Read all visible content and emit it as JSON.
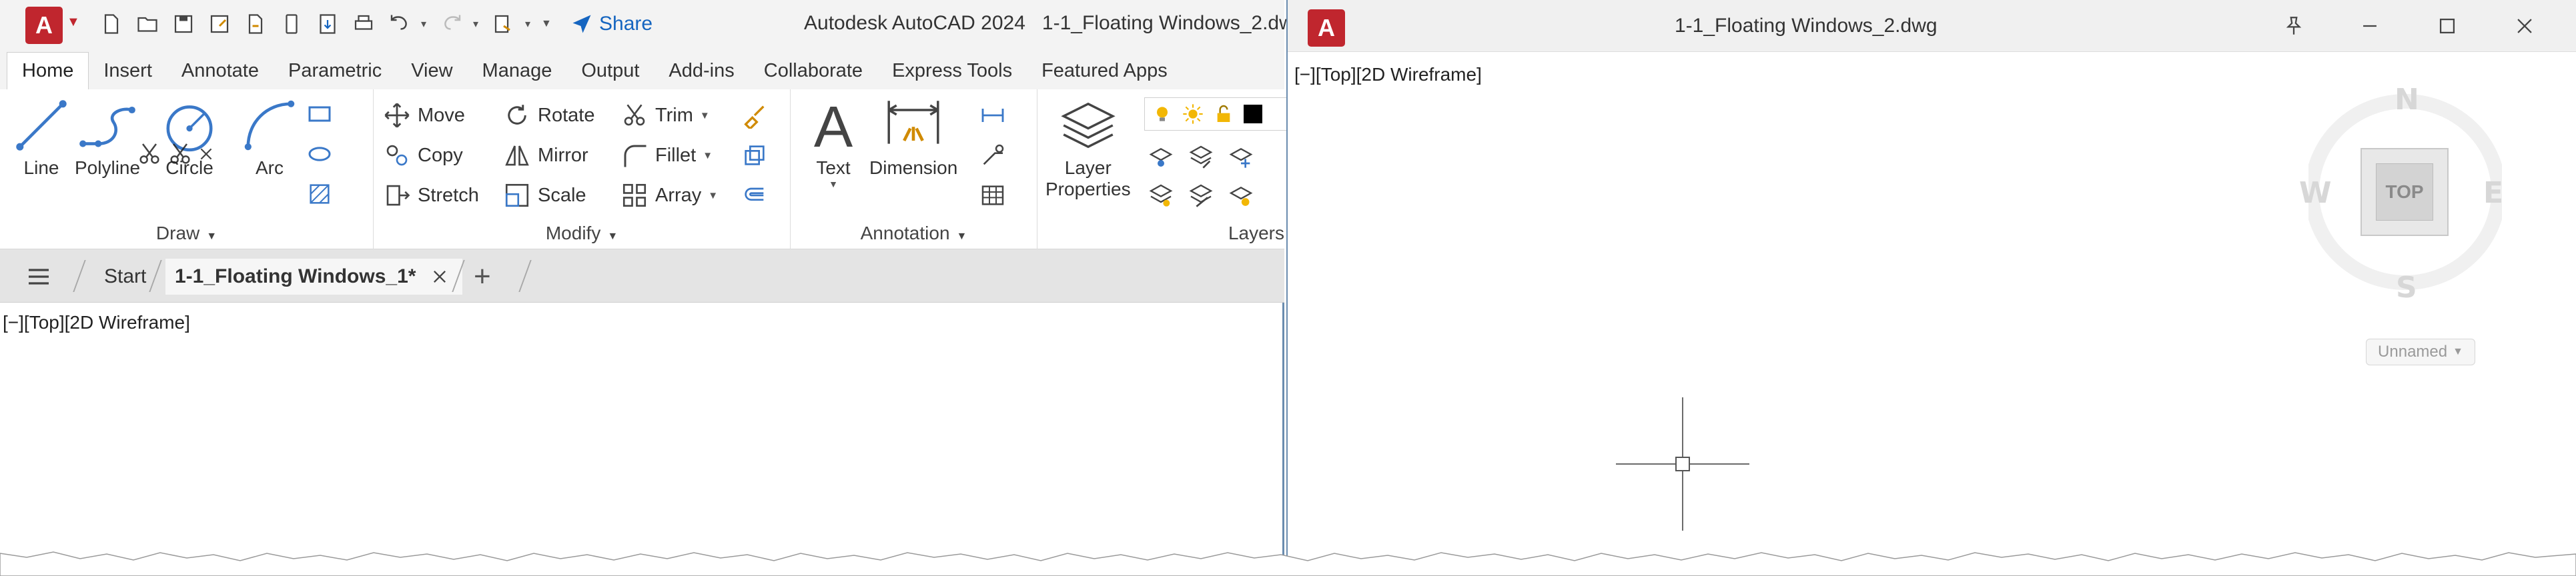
{
  "app": {
    "logo_letter": "A",
    "title": "Autodesk AutoCAD 2024",
    "current_file": "1-1_Floating Windows_2.dwg",
    "share_label": "Share",
    "accent": "#c0262e",
    "share_color": "#1565c0"
  },
  "ribbon_tabs": [
    "Home",
    "Insert",
    "Annotate",
    "Parametric",
    "View",
    "Manage",
    "Output",
    "Add-ins",
    "Collaborate",
    "Express Tools",
    "Featured Apps"
  ],
  "ribbon": {
    "draw": {
      "title": "Draw",
      "line": "Line",
      "polyline": "Polyline",
      "circle": "Circle",
      "arc": "Arc"
    },
    "modify": {
      "title": "Modify",
      "move": "Move",
      "rotate": "Rotate",
      "trim": "Trim",
      "copy": "Copy",
      "mirror": "Mirror",
      "fillet": "Fillet",
      "stretch": "Stretch",
      "scale": "Scale",
      "array": "Array"
    },
    "annotation": {
      "title": "Annotation",
      "text": "Text",
      "dimension": "Dimension"
    },
    "layers": {
      "title": "Layers",
      "properties_line1": "Layer",
      "properties_line2": "Properties"
    }
  },
  "file_tabs": {
    "start": "Start",
    "active": "1-1_Floating Windows_1*",
    "add": "+"
  },
  "viewport_main": {
    "label": "[−][Top][2D Wireframe]"
  },
  "floating_window": {
    "title": "1-1_Floating Windows_2.dwg",
    "viewport_label": "[−][Top][2D Wireframe]",
    "viewcube": {
      "north": "N",
      "south": "S",
      "east": "E",
      "west": "W",
      "face": "TOP"
    },
    "ucs": "Unnamed"
  }
}
